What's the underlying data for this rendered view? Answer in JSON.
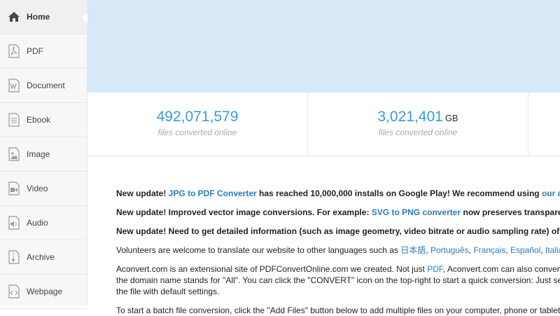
{
  "sidebar": {
    "items": [
      {
        "label": "Home",
        "icon": "home-icon"
      },
      {
        "label": "PDF",
        "icon": "pdf-icon"
      },
      {
        "label": "Document",
        "icon": "document-icon"
      },
      {
        "label": "Ebook",
        "icon": "ebook-icon"
      },
      {
        "label": "Image",
        "icon": "image-icon"
      },
      {
        "label": "Video",
        "icon": "video-icon"
      },
      {
        "label": "Audio",
        "icon": "audio-icon"
      },
      {
        "label": "Archive",
        "icon": "archive-icon"
      },
      {
        "label": "Webpage",
        "icon": "webpage-icon"
      }
    ]
  },
  "stats": {
    "files": {
      "value": "492,071,579",
      "caption": "files converted online"
    },
    "size": {
      "value": "3,021,401",
      "unit": "GB",
      "caption": "files converted online"
    }
  },
  "content": {
    "update1": {
      "prefix": "New update! ",
      "link": "JPG to PDF Converter",
      "middle": " has reached 10,000,000 installs on Google Play! We recommend using ",
      "link2": "our apps"
    },
    "update2": {
      "prefix": "New update! Improved vector image conversions. For example: ",
      "link": "SVG to PNG converter",
      "suffix": " now preserves transparent"
    },
    "update3": {
      "text": "New update! Need to get detailed information (such as image geometry, video bitrate or audio sampling rate) of y"
    },
    "volunteers": {
      "prefix": "Volunteers are welcome to translate our website to other languages such as ",
      "lang1": "日本語",
      "lang2": "Português",
      "lang3": "Français",
      "lang4": "Español",
      "lang5": "Italiano"
    },
    "about": {
      "line1_prefix": "Aconvert.com is an extensional site of PDFConvertOnline.com we created. Not just ",
      "line1_link": "PDF",
      "line1_suffix": ", Aconvert.com can also convert all",
      "line2": "the domain name stands for \"All\". You can click the \"CONVERT\" icon on the top-right to start a quick conversion: Just selec",
      "line3": "the file with default settings."
    },
    "batch": "To start a batch file conversion, click the \"Add Files\" button below to add multiple files on your computer, phone or tablet,"
  }
}
